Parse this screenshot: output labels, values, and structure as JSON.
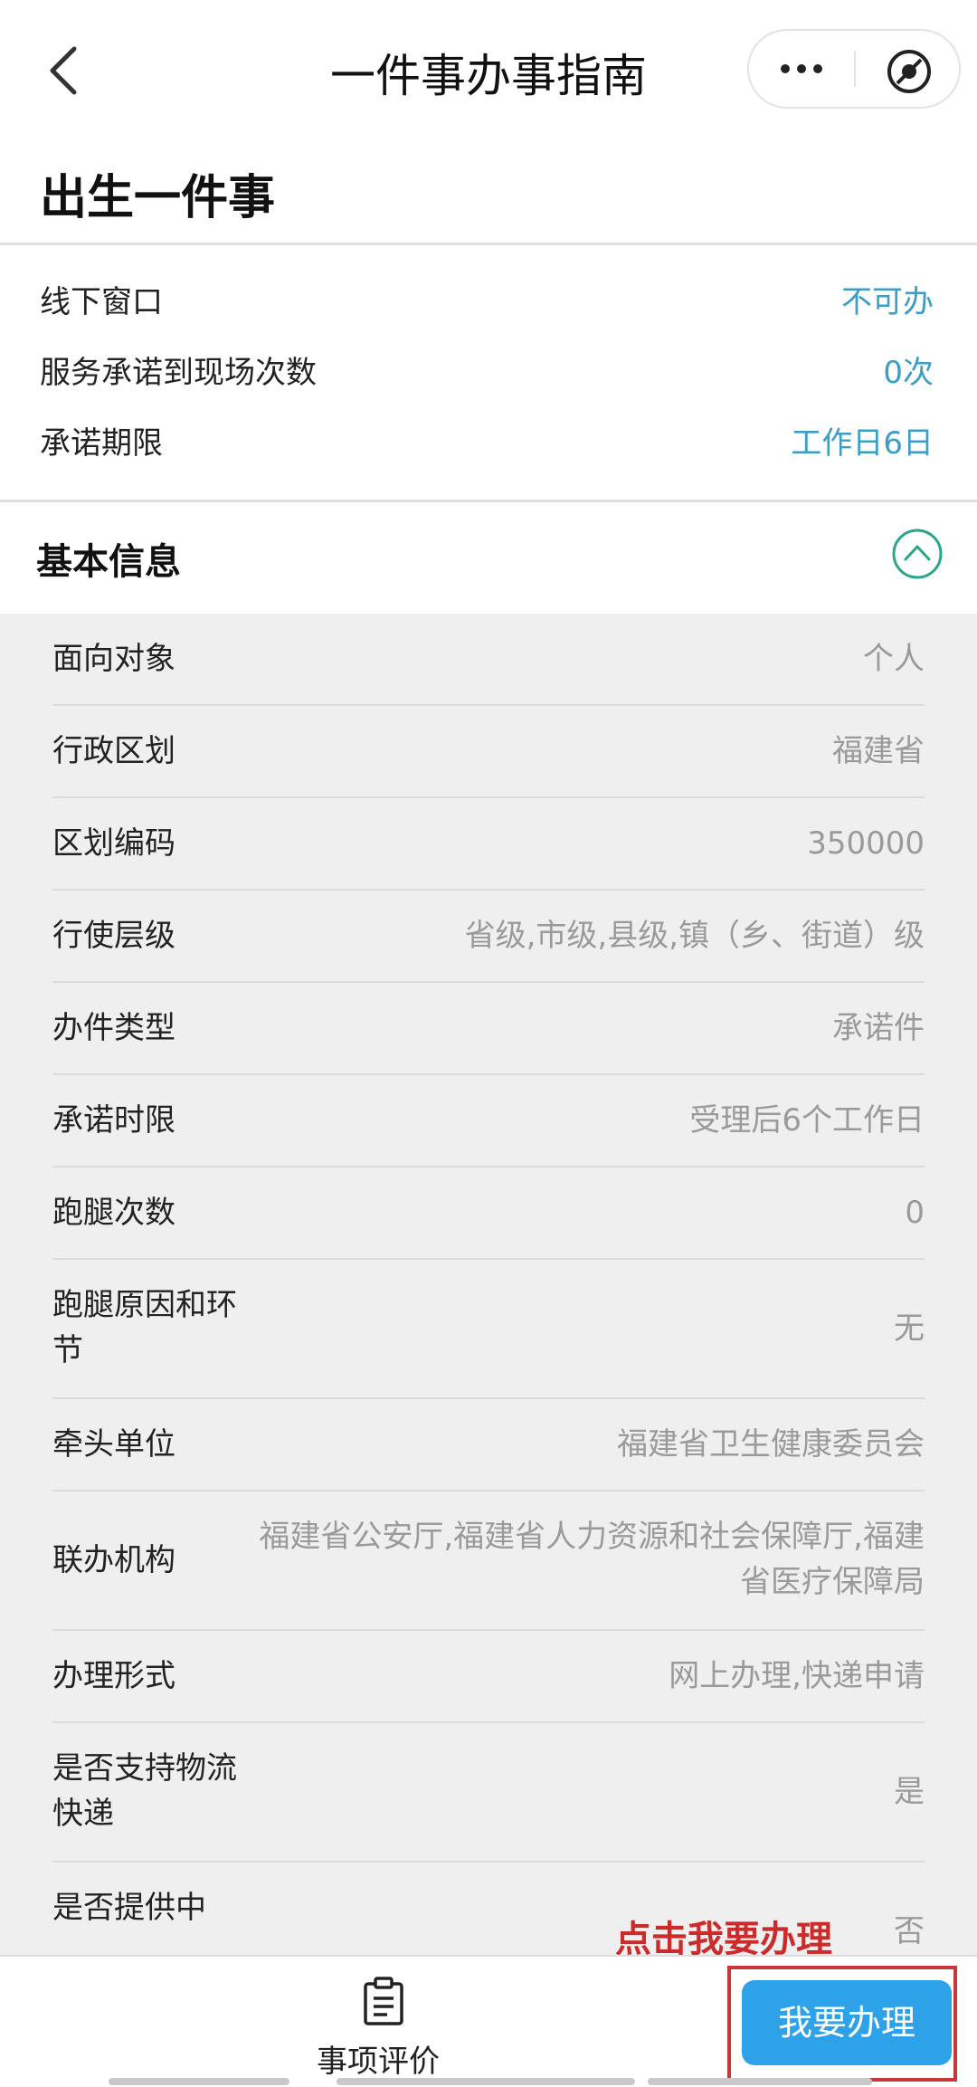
{
  "nav": {
    "title": "一件事办事指南"
  },
  "page_title": "出生一件事",
  "service_info": [
    {
      "label": "线下窗口",
      "value": "不可办"
    },
    {
      "label": "服务承诺到现场次数",
      "value": "0次"
    },
    {
      "label": "承诺期限",
      "value": "工作日6日"
    }
  ],
  "basic_info": {
    "title": "基本信息",
    "rows": [
      {
        "label": "面向对象",
        "value": "个人"
      },
      {
        "label": "行政区划",
        "value": "福建省"
      },
      {
        "label": "区划编码",
        "value": "350000"
      },
      {
        "label": "行使层级",
        "value": "省级,市级,县级,镇（乡、街道）级"
      },
      {
        "label": "办件类型",
        "value": "承诺件"
      },
      {
        "label": "承诺时限",
        "value": "受理后6个工作日"
      },
      {
        "label": "跑腿次数",
        "value": "0"
      },
      {
        "label": "跑腿原因和环节",
        "value": "无"
      },
      {
        "label": "牵头单位",
        "value": "福建省卫生健康委员会"
      },
      {
        "label": "联办机构",
        "value": "福建省公安厅,福建省人力资源和社会保障厅,福建省医疗保障局"
      },
      {
        "label": "办理形式",
        "value": "网上办理,快递申请"
      },
      {
        "label": "是否支持物流快递",
        "value": "是"
      },
      {
        "label": "是否提供中",
        "value": "否"
      }
    ]
  },
  "annotation": "点击我要办理",
  "bottom": {
    "evaluate_label": "事项评价",
    "apply_label": "我要办理"
  },
  "colors": {
    "accent": "#3a9ec8",
    "button": "#2ea2e8",
    "annotation": "#cc2b2b"
  }
}
